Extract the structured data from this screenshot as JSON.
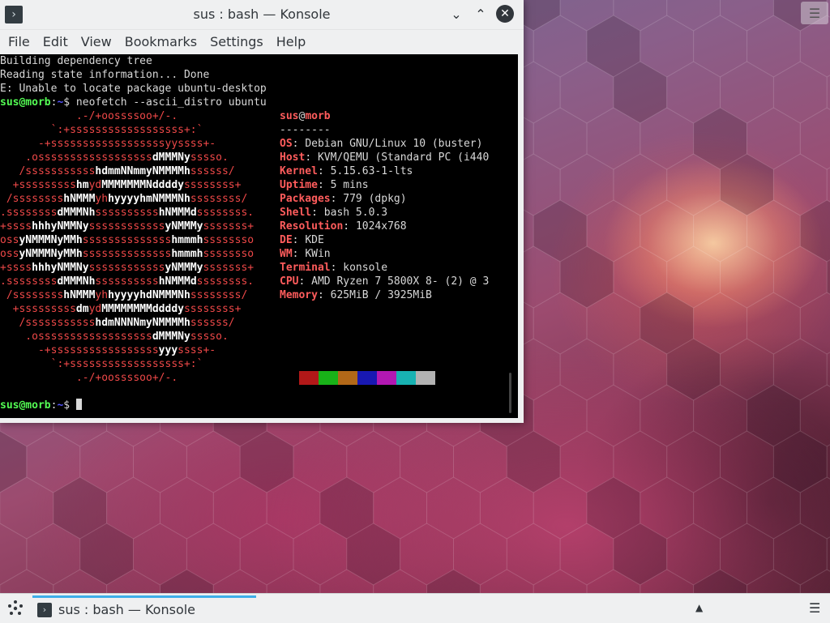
{
  "window": {
    "title": "sus : bash — Konsole",
    "icon_glyph": "›",
    "buttons": {
      "minimize": "⌄",
      "maximize": "⌃",
      "close": "✕"
    }
  },
  "menubar": [
    "File",
    "Edit",
    "View",
    "Bookmarks",
    "Settings",
    "Help"
  ],
  "terminal": {
    "output_lines": [
      "Building dependency tree",
      "Reading state information... Done",
      "E: Unable to locate package ubuntu-desktop"
    ],
    "prompt_user": "sus@morb",
    "prompt_sep": ":",
    "prompt_path": "~",
    "prompt_symbol": "$",
    "command": " neofetch --ascii_distro ubuntu",
    "ascii_art": [
      [
        [
          "r",
          "            .-/+oossssoo+/-."
        ]
      ],
      [
        [
          "r",
          "        `:+ssssssssssssssssss+:`"
        ]
      ],
      [
        [
          "r",
          "      -+ssssssssssssssssssyyssss+-"
        ]
      ],
      [
        [
          "r",
          "    .ossssssssssssssssss"
        ],
        [
          "w",
          "dMMMNy"
        ],
        [
          "r",
          "sssso."
        ]
      ],
      [
        [
          "r",
          "   /sssssssssss"
        ],
        [
          "w",
          "hdmmNNmmyNMMMMh"
        ],
        [
          "r",
          "ssssss/"
        ]
      ],
      [
        [
          "r",
          "  +sssssssss"
        ],
        [
          "w",
          "hm"
        ],
        [
          "r",
          "yd"
        ],
        [
          "w",
          "MMMMMMMNddddy"
        ],
        [
          "r",
          "ssssssss+"
        ]
      ],
      [
        [
          "r",
          " /ssssssss"
        ],
        [
          "w",
          "hNMMM"
        ],
        [
          "r",
          "yh"
        ],
        [
          "w",
          "hyyyyhmNMMMNh"
        ],
        [
          "r",
          "ssssssss/"
        ]
      ],
      [
        [
          "r",
          ".ssssssss"
        ],
        [
          "w",
          "dMMMNh"
        ],
        [
          "r",
          "ssssssssss"
        ],
        [
          "w",
          "hNMMMd"
        ],
        [
          "r",
          "ssssssss."
        ]
      ],
      [
        [
          "r",
          "+ssss"
        ],
        [
          "w",
          "hhhyNMMNy"
        ],
        [
          "r",
          "ssssssssssss"
        ],
        [
          "w",
          "yNMMMy"
        ],
        [
          "r",
          "sssssss+"
        ]
      ],
      [
        [
          "r",
          "oss"
        ],
        [
          "w",
          "yNMMMNyMMh"
        ],
        [
          "r",
          "ssssssssssssss"
        ],
        [
          "w",
          "hmmmh"
        ],
        [
          "r",
          "ssssssso"
        ]
      ],
      [
        [
          "r",
          "oss"
        ],
        [
          "w",
          "yNMMMNyMMh"
        ],
        [
          "r",
          "ssssssssssssss"
        ],
        [
          "w",
          "hmmmh"
        ],
        [
          "r",
          "ssssssso"
        ]
      ],
      [
        [
          "r",
          "+ssss"
        ],
        [
          "w",
          "hhhyNMMNy"
        ],
        [
          "r",
          "ssssssssssss"
        ],
        [
          "w",
          "yNMMMy"
        ],
        [
          "r",
          "sssssss+"
        ]
      ],
      [
        [
          "r",
          ".ssssssss"
        ],
        [
          "w",
          "dMMMNh"
        ],
        [
          "r",
          "ssssssssss"
        ],
        [
          "w",
          "hNMMMd"
        ],
        [
          "r",
          "ssssssss."
        ]
      ],
      [
        [
          "r",
          " /ssssssss"
        ],
        [
          "w",
          "hNMMM"
        ],
        [
          "r",
          "yh"
        ],
        [
          "w",
          "hyyyyhdNMMMNh"
        ],
        [
          "r",
          "ssssssss/"
        ]
      ],
      [
        [
          "r",
          "  +sssssssss"
        ],
        [
          "w",
          "dm"
        ],
        [
          "r",
          "yd"
        ],
        [
          "w",
          "MMMMMMMMddddy"
        ],
        [
          "r",
          "ssssssss+"
        ]
      ],
      [
        [
          "r",
          "   /sssssssssss"
        ],
        [
          "w",
          "hdmNNNNmyNMMMMh"
        ],
        [
          "r",
          "ssssss/"
        ]
      ],
      [
        [
          "r",
          "    .ossssssssssssssssss"
        ],
        [
          "w",
          "dMMMNy"
        ],
        [
          "r",
          "sssso."
        ]
      ],
      [
        [
          "r",
          "      -+sssssssssssssssss"
        ],
        [
          "w",
          "yyy"
        ],
        [
          "r",
          "ssss+-"
        ]
      ],
      [
        [
          "r",
          "        `:+ssssssssssssssssss+:`"
        ]
      ],
      [
        [
          "r",
          "            .-/+oossssoo+/-."
        ]
      ]
    ],
    "info_header": {
      "user": "sus",
      "at": "@",
      "host": "morb",
      "divider": "--------"
    },
    "info": [
      {
        "key": "OS",
        "value": "Debian GNU/Linux 10 (buster)"
      },
      {
        "key": "Host",
        "value": "KVM/QEMU (Standard PC (i440"
      },
      {
        "key": "Kernel",
        "value": "5.15.63-1-lts"
      },
      {
        "key": "Uptime",
        "value": "5 mins"
      },
      {
        "key": "Packages",
        "value": "779 (dpkg)"
      },
      {
        "key": "Shell",
        "value": "bash 5.0.3"
      },
      {
        "key": "Resolution",
        "value": "1024x768"
      },
      {
        "key": "DE",
        "value": "KDE"
      },
      {
        "key": "WM",
        "value": "KWin"
      },
      {
        "key": "Terminal",
        "value": "konsole"
      },
      {
        "key": "CPU",
        "value": "AMD Ryzen 7 5800X 8- (2) @ 3"
      },
      {
        "key": "Memory",
        "value": "625MiB / 3925MiB"
      }
    ],
    "palette": [
      "#b21818",
      "#18b218",
      "#b26818",
      "#1818b2",
      "#b218b2",
      "#18b2b2",
      "#b2b2b2"
    ]
  },
  "taskbar": {
    "task_label": "sus : bash — Konsole",
    "kicker_icon": "application-launcher-icon",
    "tray_arrow": "▲",
    "menu_glyph": "☰"
  },
  "desktop": {
    "menu_glyph": "☰"
  }
}
